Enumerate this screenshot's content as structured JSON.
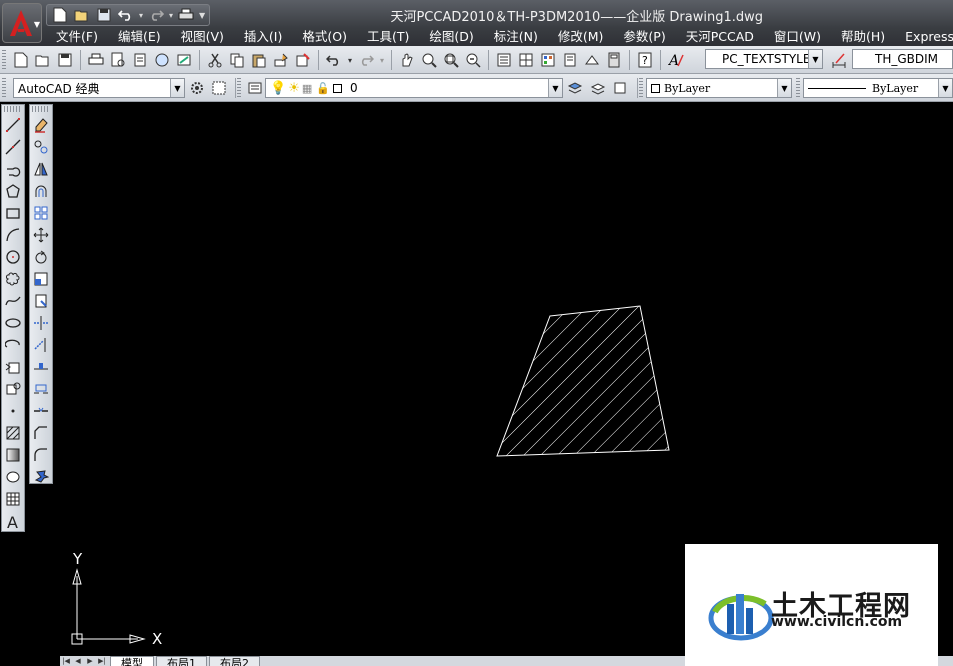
{
  "window": {
    "title": "天河PCCAD2010＆TH-P3DM2010——企业版    Drawing1.dwg"
  },
  "quick_access": {
    "icons": [
      "new-icon",
      "open-icon",
      "save-icon",
      "undo-icon",
      "redo-icon",
      "plot-icon"
    ]
  },
  "menu": {
    "items": [
      "文件(F)",
      "编辑(E)",
      "视图(V)",
      "插入(I)",
      "格式(O)",
      "工具(T)",
      "绘图(D)",
      "标注(N)",
      "修改(M)",
      "参数(P)",
      "天河PCCAD",
      "窗口(W)",
      "帮助(H)",
      "Express"
    ]
  },
  "standard_toolbar": {
    "text_style": "PC_TEXTSTYLE",
    "dim_style": "TH_GBDIM"
  },
  "layers_toolbar": {
    "workspace": "AutoCAD 经典",
    "current_layer": "0",
    "color": "ByLayer",
    "linetype": "ByLayer"
  },
  "layout_tabs": [
    "模型",
    "布局1",
    "布局2"
  ],
  "ucs": {
    "x_label": "X",
    "y_label": "Y"
  },
  "watermark": {
    "title": "土木工程网",
    "url": "www.civilcn.com"
  },
  "colors": {
    "canvas": "#000000",
    "hatch": "#ffffff",
    "toolbar": "#dde1e6"
  }
}
